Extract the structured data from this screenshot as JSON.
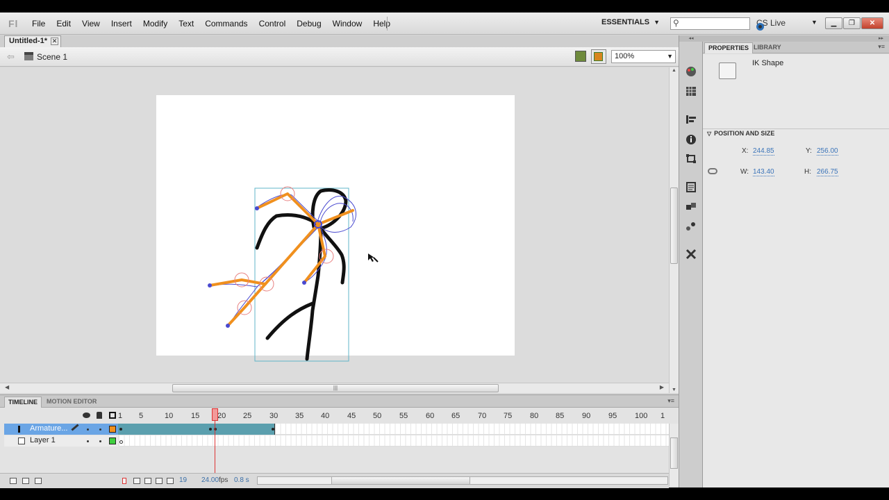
{
  "app": {
    "logo": "Fl",
    "menu": [
      "File",
      "Edit",
      "View",
      "Insert",
      "Modify",
      "Text",
      "Commands",
      "Control",
      "Debug",
      "Window",
      "Help"
    ],
    "workspace": "ESSENTIALS",
    "search_placeholder": "",
    "cs_live": "CS Live"
  },
  "document": {
    "tab_title": "Untitled-1*",
    "scene": "Scene 1",
    "zoom": "100%"
  },
  "timeline": {
    "tabs": [
      "TIMELINE",
      "MOTION EDITOR"
    ],
    "frame_numbers": [
      "1",
      "5",
      "10",
      "15",
      "20",
      "25",
      "30",
      "35",
      "40",
      "45",
      "50",
      "55",
      "60",
      "65",
      "70",
      "75",
      "80",
      "85",
      "90",
      "95",
      "100",
      "1"
    ],
    "layers": [
      {
        "name": "Armature...",
        "color": "#f0901e",
        "selected": true
      },
      {
        "name": "Layer 1",
        "color": "#3fcf3f",
        "selected": false
      }
    ],
    "current_frame": "19",
    "fps": "24.00",
    "fps_unit": "fps",
    "time": "0.8 s"
  },
  "properties": {
    "tabs": [
      "PROPERTIES",
      "LIBRARY"
    ],
    "object_type": "IK Shape",
    "section_title": "POSITION AND SIZE",
    "x_label": "X:",
    "x_value": "244.85",
    "y_label": "Y:",
    "y_value": "256.00",
    "w_label": "W:",
    "w_value": "143.40",
    "h_label": "H:",
    "h_value": "266.75"
  },
  "colors": {
    "armature_bone": "#f0901e",
    "selection": "#5fb5c9",
    "link_value": "#3b74b9",
    "playhead": "#dd3333"
  },
  "icons": [
    "search-icon",
    "close-icon",
    "back-arrow-icon",
    "scene-icon",
    "edit-symbols-icon",
    "edit-scene-icon",
    "eye-icon",
    "lock-icon",
    "outline-icon",
    "pencil-icon",
    "ik-shape-icon",
    "link-icon",
    "bone-cursor-icon"
  ]
}
